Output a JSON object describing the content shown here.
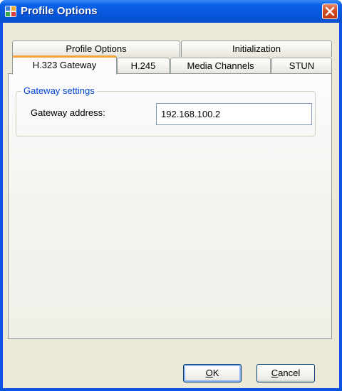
{
  "window": {
    "title": "Profile Options",
    "title_bar_color": "#0a54e1"
  },
  "tabs_row_back": [
    {
      "label": "Profile Options"
    },
    {
      "label": "Initialization"
    }
  ],
  "tabs_row_front": [
    {
      "label": "H.323 Gateway",
      "active": true
    },
    {
      "label": "H.245"
    },
    {
      "label": "Media Channels"
    },
    {
      "label": "STUN"
    }
  ],
  "gateway": {
    "group_label": "Gateway settings",
    "address_label": "Gateway address:",
    "address_value": "192.168.100.2"
  },
  "buttons": {
    "ok_mnemonic": "O",
    "ok_rest": "K",
    "cancel_mnemonic": "C",
    "cancel_rest": "ancel"
  },
  "icons": {
    "app": "app-icon",
    "close": "close-icon"
  }
}
